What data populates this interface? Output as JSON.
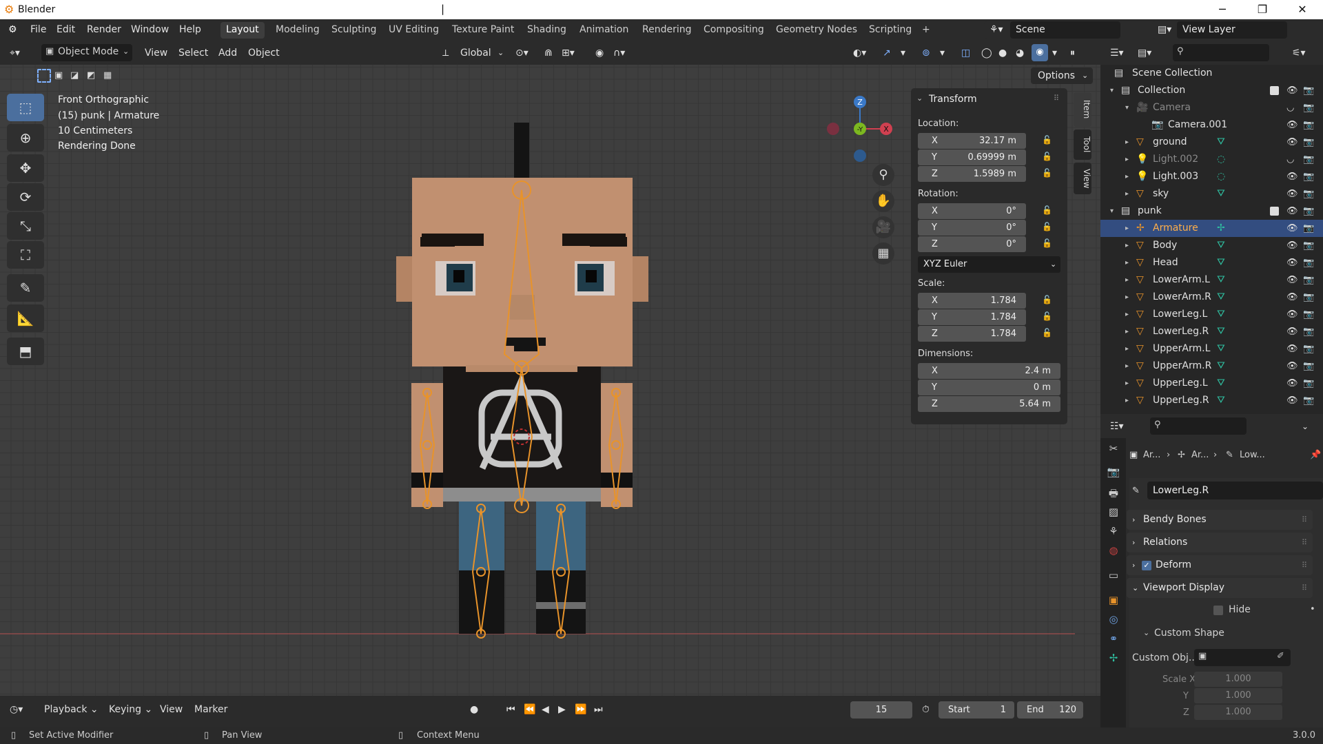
{
  "window": {
    "title": "Blender",
    "caret": "|",
    "minimize": "─",
    "maximize": "❐",
    "close": "✕"
  },
  "menu": [
    "File",
    "Edit",
    "Render",
    "Window",
    "Help"
  ],
  "workspaces": [
    "Layout",
    "Modeling",
    "Sculpting",
    "UV Editing",
    "Texture Paint",
    "Shading",
    "Animation",
    "Rendering",
    "Compositing",
    "Geometry Nodes",
    "Scripting"
  ],
  "workspace_add": "+",
  "scene": "Scene",
  "view_layer": "View Layer",
  "header": {
    "mode": "Object Mode",
    "view": "View",
    "select": "Select",
    "add": "Add",
    "object": "Object",
    "orientation": "Global",
    "options": "Options"
  },
  "viewport": {
    "info": [
      "Front Orthographic",
      "(15) punk | Armature",
      "10 Centimeters",
      "Rendering Done"
    ],
    "gizmo": {
      "z": "Z",
      "y": "-Y",
      "x": "X"
    }
  },
  "tool_icons": [
    "select-box-icon",
    "cursor-icon",
    "move-icon",
    "rotate-icon",
    "scale-icon",
    "transform-icon",
    "annotate-icon",
    "measure-icon",
    "add-cube-icon"
  ],
  "npanel": {
    "title": "Transform",
    "location_label": "Location:",
    "location": [
      {
        "axis": "X",
        "value": "32.17 m"
      },
      {
        "axis": "Y",
        "value": "0.69999 m"
      },
      {
        "axis": "Z",
        "value": "1.5989 m"
      }
    ],
    "rotation_label": "Rotation:",
    "rotation": [
      {
        "axis": "X",
        "value": "0°"
      },
      {
        "axis": "Y",
        "value": "0°"
      },
      {
        "axis": "Z",
        "value": "0°"
      }
    ],
    "rotation_mode": "XYZ Euler",
    "scale_label": "Scale:",
    "scale": [
      {
        "axis": "X",
        "value": "1.784"
      },
      {
        "axis": "Y",
        "value": "1.784"
      },
      {
        "axis": "Z",
        "value": "1.784"
      }
    ],
    "dimensions_label": "Dimensions:",
    "dimensions": [
      {
        "axis": "X",
        "value": "2.4 m"
      },
      {
        "axis": "Y",
        "value": "0 m"
      },
      {
        "axis": "Z",
        "value": "5.64 m"
      }
    ],
    "tabs": [
      "Item",
      "Tool",
      "View"
    ]
  },
  "outliner": {
    "root": "Scene Collection",
    "rows": [
      {
        "name": "Collection",
        "indent": 1,
        "type": "collection",
        "expanded": true
      },
      {
        "name": "Camera",
        "indent": 2,
        "type": "camera",
        "dim": true,
        "expanded": true
      },
      {
        "name": "Camera.001",
        "indent": 3,
        "type": "camdata"
      },
      {
        "name": "ground",
        "indent": 2,
        "type": "mesh"
      },
      {
        "name": "Light.002",
        "indent": 2,
        "type": "light",
        "dim": true
      },
      {
        "name": "Light.003",
        "indent": 2,
        "type": "light"
      },
      {
        "name": "sky",
        "indent": 2,
        "type": "mesh"
      },
      {
        "name": "punk",
        "indent": 1,
        "type": "collection",
        "expanded": true
      },
      {
        "name": "Armature",
        "indent": 2,
        "type": "armature",
        "selected": true
      },
      {
        "name": "Body",
        "indent": 2,
        "type": "mesh"
      },
      {
        "name": "Head",
        "indent": 2,
        "type": "mesh"
      },
      {
        "name": "LowerArm.L",
        "indent": 2,
        "type": "mesh"
      },
      {
        "name": "LowerArm.R",
        "indent": 2,
        "type": "mesh"
      },
      {
        "name": "LowerLeg.L",
        "indent": 2,
        "type": "mesh"
      },
      {
        "name": "LowerLeg.R",
        "indent": 2,
        "type": "mesh"
      },
      {
        "name": "UpperArm.L",
        "indent": 2,
        "type": "mesh"
      },
      {
        "name": "UpperArm.R",
        "indent": 2,
        "type": "mesh"
      },
      {
        "name": "UpperLeg.L",
        "indent": 2,
        "type": "mesh"
      },
      {
        "name": "UpperLeg.R",
        "indent": 2,
        "type": "mesh"
      }
    ]
  },
  "properties": {
    "breadcrumb": [
      "Ar...",
      "Ar...",
      "Low..."
    ],
    "bone_name": "LowerLeg.R",
    "sections": [
      "Bendy Bones",
      "Relations",
      "Deform",
      "Viewport Display"
    ],
    "hide_label": "Hide",
    "custom_shape": "Custom Shape",
    "custom_obj_label": "Custom Obj...",
    "scale_x_label": "Scale X",
    "scale_y_label": "Y",
    "scale_z_label": "Z",
    "scale_x": "1.000",
    "scale_y": "1.000",
    "scale_z": "1.000"
  },
  "timeline": {
    "playback": "Playback",
    "keying": "Keying",
    "view": "View",
    "marker": "Marker",
    "current_frame": "15",
    "start_label": "Start",
    "start": "1",
    "end_label": "End",
    "end": "120"
  },
  "status": {
    "left": "Set Active Modifier",
    "middle": "Pan View",
    "right": "Context Menu",
    "version": "3.0.0"
  },
  "colors": {
    "accent": "#4b6f9e",
    "selection": "#334d80",
    "bone": "#e8932a",
    "skin": "#c0906a",
    "shirt": "#1a1716",
    "jeans": "#3d6580"
  }
}
